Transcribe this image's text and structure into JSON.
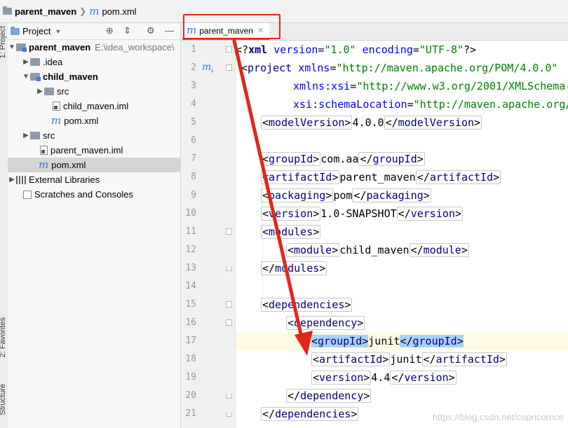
{
  "breadcrumb": {
    "project": "parent_maven",
    "file": "pom.xml"
  },
  "sidebar": {
    "vertical_tabs": [
      "1: Project",
      "2: Favorites",
      "Structure"
    ],
    "toolbar_label": "Project",
    "tree": [
      {
        "label": "parent_maven",
        "path": "E:\\idea_workspace\\"
      },
      {
        "label": ".idea"
      },
      {
        "label": "child_maven"
      },
      {
        "label": "src"
      },
      {
        "label": "child_maven.iml"
      },
      {
        "label": "pom.xml"
      },
      {
        "label": "src"
      },
      {
        "label": "parent_maven.iml"
      },
      {
        "label": "pom.xml"
      },
      {
        "label": "External Libraries"
      },
      {
        "label": "Scratches and Consoles"
      }
    ]
  },
  "editor": {
    "tab_label": "parent_maven",
    "line_numbers": [
      "1",
      "2",
      "3",
      "4",
      "5",
      "6",
      "7",
      "8",
      "9",
      "10",
      "11",
      "12",
      "13",
      "14",
      "15",
      "16",
      "17",
      "18",
      "19",
      "20",
      "21"
    ],
    "code": {
      "l1": {
        "pi_open": "<?",
        "xml": "xml",
        "version_attr": "version",
        "version_val": "\"1.0\"",
        "encoding_attr": "encoding",
        "encoding_val": "\"UTF-8\"",
        "pi_close": "?>"
      },
      "l2": {
        "lt": "<",
        "name": "project",
        "attr": "xmlns",
        "eq": "=",
        "val": "\"http://maven.apache.org/POM/4.0.0\""
      },
      "l3": {
        "attr": "xmlns:xsi",
        "eq": "=",
        "val": "\"http://www.w3.org/2001/XMLSchema-"
      },
      "l4": {
        "attr": "xsi:schemaLocation",
        "eq": "=",
        "val": "\"http://maven.apache.org/"
      },
      "tag_modelVersion": "modelVersion",
      "v_modelVersion": "4.0.0",
      "tag_groupId": "groupId",
      "v_groupId": "com.aa",
      "tag_artifactId": "artifactId",
      "v_artifactId": "parent_maven",
      "tag_packaging": "packaging",
      "v_packaging": "pom",
      "tag_version": "version",
      "v_version": "1.0-SNAPSHOT",
      "tag_modules": "modules",
      "tag_module": "module",
      "v_module": "child_maven",
      "tag_dependencies": "dependencies",
      "tag_dependency": "dependency",
      "v_dep_groupId": "junit",
      "v_dep_artifactId": "junit",
      "v_dep_version": "4.4"
    }
  },
  "watermark": "https://blog.csdn.net/capricornce",
  "colors": {
    "annotation": "#e1261c",
    "tag": "#000080",
    "attr": "#0000ff",
    "value": "#008000",
    "match": "#a6d2ff"
  }
}
